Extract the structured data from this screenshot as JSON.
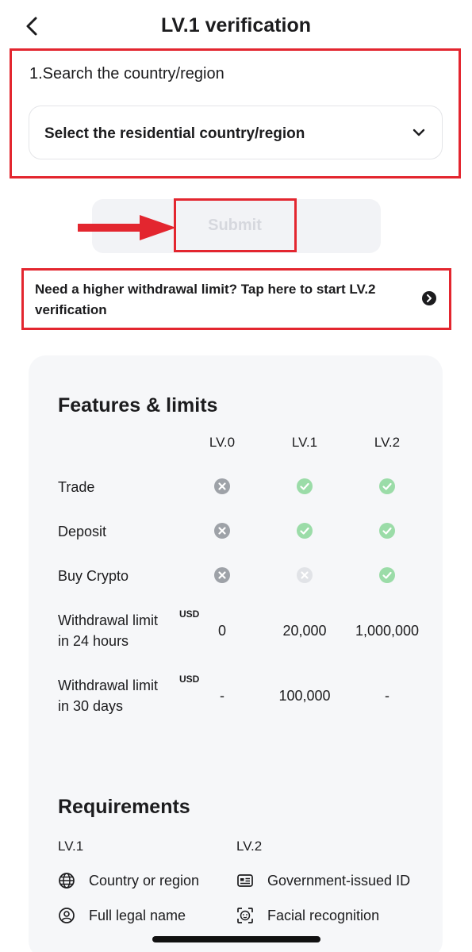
{
  "header": {
    "title": "LV.1 verification"
  },
  "search": {
    "section_label": "1.Search the country/region",
    "select_value": "Select the residential country/region"
  },
  "submit": {
    "label": "Submit"
  },
  "lv2_banner": {
    "text": "Need a higher withdrawal limit? Tap here to start LV.2 verification"
  },
  "features": {
    "title": "Features & limits",
    "columns": [
      "LV.0",
      "LV.1",
      "LV.2"
    ],
    "rows": [
      {
        "label": "Trade",
        "values": [
          "no",
          "yes",
          "yes"
        ]
      },
      {
        "label": "Deposit",
        "values": [
          "no",
          "yes",
          "yes"
        ]
      },
      {
        "label": "Buy Crypto",
        "values": [
          "no",
          "disabled",
          "yes"
        ]
      },
      {
        "label_line1": "Withdrawal limit",
        "label_line2": "in 24 hours",
        "unit": "USD",
        "values": [
          "0",
          "20,000",
          "1,000,000"
        ]
      },
      {
        "label_line1": "Withdrawal limit",
        "label_line2": "in 30 days",
        "unit": "USD",
        "values": [
          "-",
          "100,000",
          "-"
        ]
      }
    ]
  },
  "requirements": {
    "title": "Requirements",
    "lv1": {
      "heading": "LV.1",
      "items": [
        {
          "label": "Country or region",
          "icon": "globe-icon"
        },
        {
          "label": "Full legal name",
          "icon": "user-icon"
        }
      ]
    },
    "lv2": {
      "heading": "LV.2",
      "items": [
        {
          "label": "Government-issued ID",
          "icon": "id-card-icon"
        },
        {
          "label": "Facial recognition",
          "icon": "face-scan-icon"
        }
      ]
    }
  },
  "colors": {
    "highlight_red": "#e3262f",
    "check_green": "#9bdca8",
    "cross_gray": "#9ea2a8",
    "disabled_gray": "#d6d8de"
  }
}
